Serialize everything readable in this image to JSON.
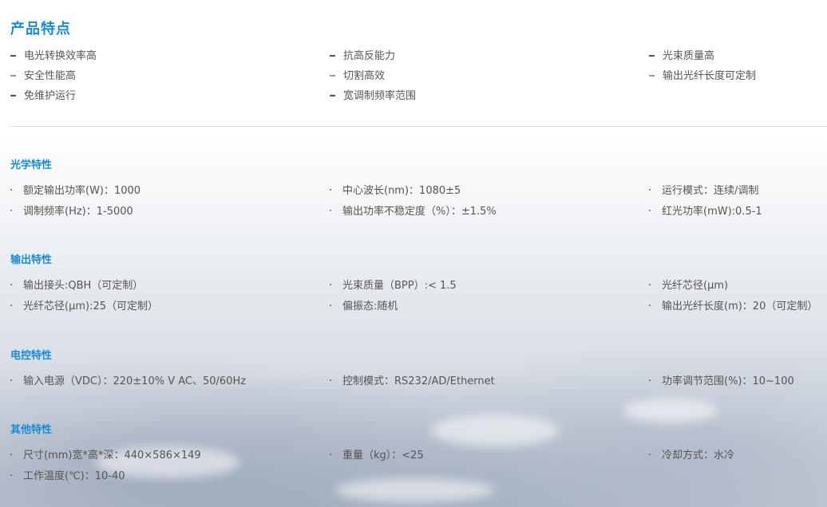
{
  "title": "产品特点",
  "features": [
    [
      "电光转换效率高",
      "抗高反能力",
      "光束质量高"
    ],
    [
      "安全性能高",
      "切割高效",
      "输出光纤长度可定制"
    ],
    [
      "免维护运行",
      "宽调制频率范围",
      ""
    ]
  ],
  "sections": [
    {
      "title": "光学特性",
      "rows": [
        [
          "额定输出功率(W)：1000",
          "中心波长(nm)：1080±5",
          "运行模式：连续/调制"
        ],
        [
          "调制频率(Hz)：1-5000",
          "输出功率不稳定度（%）：±1.5%",
          "红光功率(mW):0.5-1"
        ]
      ]
    },
    {
      "title": "输出特性",
      "rows": [
        [
          "输出接头:QBH（可定制）",
          "光束质量（BPP）:< 1.5",
          "光纤芯径(μm)"
        ],
        [
          "光纤芯径(μm):25（可定制）",
          "偏振态:随机",
          "输出光纤长度(m)：20（可定制）"
        ]
      ]
    },
    {
      "title": "电控特性",
      "rows": [
        [
          "输入电源（VDC）：220±10% V AC、50/60Hz",
          "控制模式：RS232/AD/Ethernet",
          "功率调节范围(%)：10~100"
        ]
      ]
    },
    {
      "title": "其他特性",
      "rows": [
        [
          "尺寸(mm)宽*高*深：440×586×149",
          "重量（kg）：<25",
          "冷却方式：水冷"
        ],
        [
          "工作温度(℃)：10-40",
          "",
          ""
        ]
      ]
    }
  ]
}
